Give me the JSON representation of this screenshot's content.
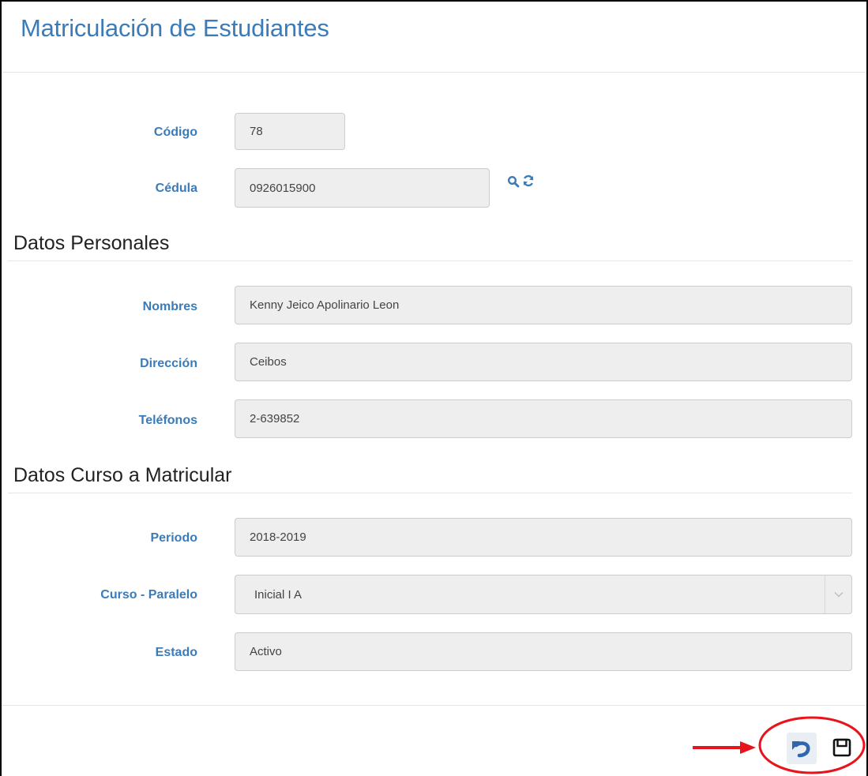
{
  "header": {
    "title": "Matriculación de Estudiantes"
  },
  "form": {
    "codigo": {
      "label": "Código",
      "value": "78"
    },
    "cedula": {
      "label": "Cédula",
      "value": "0926015900"
    },
    "datos_personales": {
      "title": "Datos Personales",
      "nombres": {
        "label": "Nombres",
        "value": "Kenny Jeico Apolinario Leon"
      },
      "direccion": {
        "label": "Dirección",
        "value": "Ceibos"
      },
      "telefonos": {
        "label": "Teléfonos",
        "value": "2-639852"
      }
    },
    "datos_curso": {
      "title": "Datos Curso a Matricular",
      "periodo": {
        "label": "Periodo",
        "value": "2018-2019"
      },
      "curso_paralelo": {
        "label": "Curso - Paralelo",
        "value": "Inicial I A"
      },
      "estado": {
        "label": "Estado",
        "value": "Activo"
      }
    }
  },
  "icons": {
    "search": "search-icon",
    "refresh": "refresh-icon",
    "chevron": "chevron-down-icon",
    "undo": "undo-icon",
    "save": "save-icon",
    "arrow": "arrow-right-icon"
  },
  "colors": {
    "accent": "#3a7bb9",
    "field_bg": "#eeeeee",
    "annotation": "#e8131b"
  }
}
